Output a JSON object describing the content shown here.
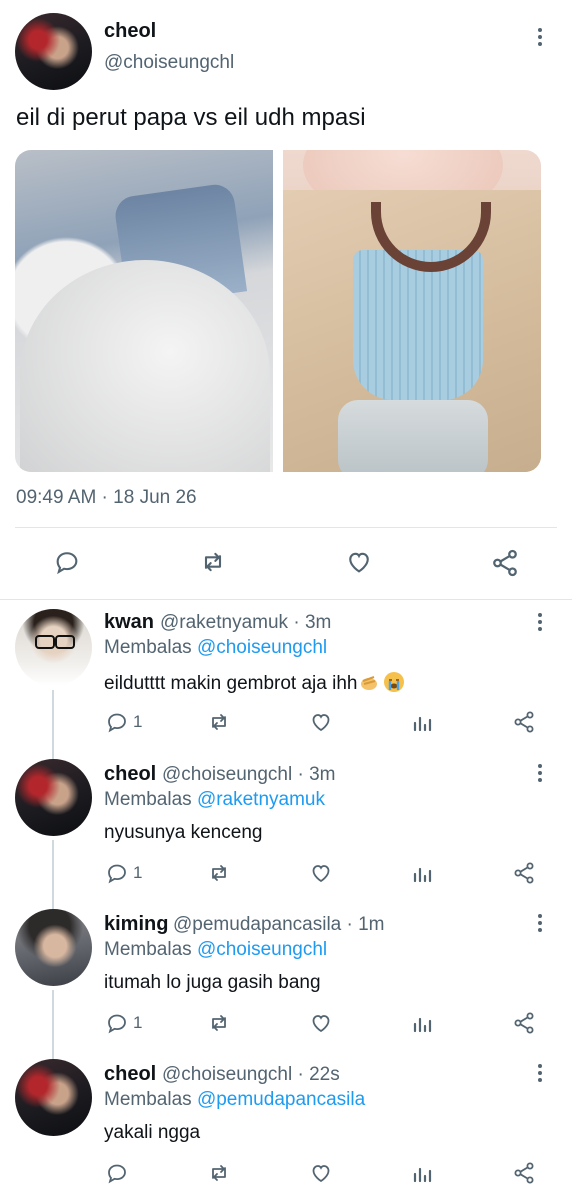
{
  "main_tweet": {
    "name": "cheol",
    "handle": "@choiseungchl",
    "text": "eil di perut papa vs eil udh mpasi",
    "timestamp": "09:49 AM · 18 Jun 26",
    "actions": [
      "reply-icon",
      "retweet-icon",
      "like-icon",
      "share-icon"
    ]
  },
  "replies": [
    {
      "name": "kwan",
      "handle_time": "@raketnyamuk · 3m",
      "reply_label": "Membalas",
      "reply_to": "@choiseungchl",
      "text": "eildutttt makin gembrot aja ihh",
      "emojis": [
        "pinching-hand-emoji",
        "crying-face-emoji"
      ],
      "reply_count": "1"
    },
    {
      "name": "cheol",
      "handle_time": "@choiseungchl · 3m",
      "reply_label": "Membalas",
      "reply_to": "@raketnyamuk",
      "text": "nyusunya kenceng",
      "reply_count": "1"
    },
    {
      "name": "kiming",
      "handle_time": "@pemudapancasila · 1m",
      "reply_label": "Membalas",
      "reply_to": "@choiseungchl",
      "text": "itumah lo juga gasih bang",
      "reply_count": "1"
    },
    {
      "name": "cheol",
      "handle_time": "@choiseungchl · 22s",
      "reply_label": "Membalas",
      "reply_to": "@pemudapancasila",
      "text": "yakali ngga",
      "reply_count": ""
    }
  ],
  "colors": {
    "text": "#0f1419",
    "secondary": "#536471",
    "link": "#1d9bf0",
    "divider": "#e1e6ea"
  }
}
